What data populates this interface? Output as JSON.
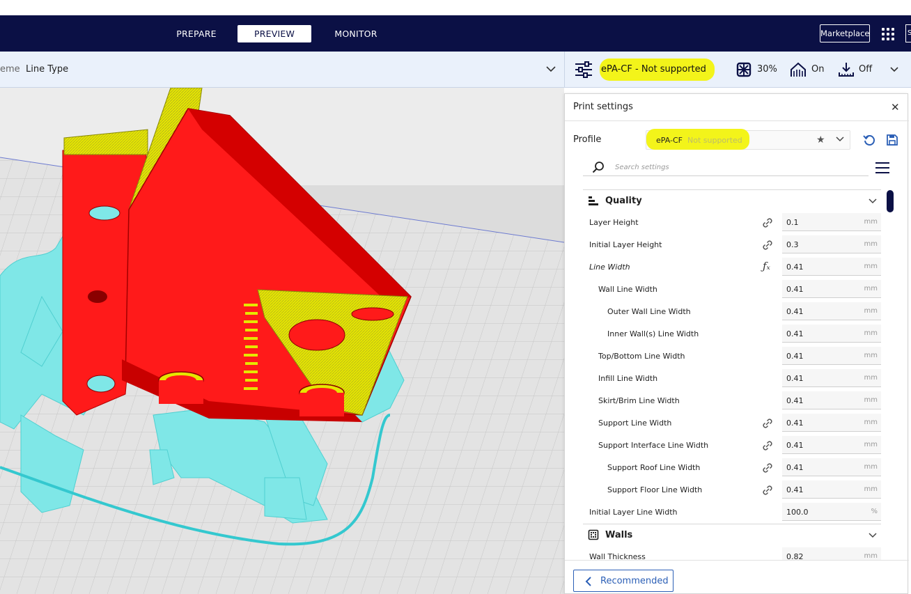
{
  "header": {
    "stage_tabs": [
      {
        "label": "PREPARE",
        "active": false
      },
      {
        "label": "PREVIEW",
        "active": true
      },
      {
        "label": "MONITOR",
        "active": false
      }
    ],
    "marketplace_label": "Marketplace",
    "cut_button_label": "S"
  },
  "view_bar": {
    "scheme_label": "eme",
    "scheme_value": "Line Type"
  },
  "print_bar": {
    "profile_label": "ePA-CF - Not supported",
    "infill_value": "30%",
    "support_value": "On",
    "adhesion_value": "Off",
    "highlight_color": "#f3f41a"
  },
  "panel": {
    "title": "Print settings",
    "profile_label": "Profile",
    "profile_name": "ePA-CF",
    "profile_status": "Not supported",
    "search_placeholder": "Search settings",
    "categories": [
      {
        "label": "Quality",
        "icon": "quality-icon"
      },
      {
        "label": "Walls",
        "icon": "walls-icon"
      }
    ],
    "settings": [
      {
        "label": "Layer Height",
        "value": "0.1",
        "unit": "mm",
        "link": true,
        "fx": false,
        "indent": 0,
        "italic": false
      },
      {
        "label": "Initial Layer Height",
        "value": "0.3",
        "unit": "mm",
        "link": true,
        "fx": false,
        "indent": 0,
        "italic": false
      },
      {
        "label": "Line Width",
        "value": "0.41",
        "unit": "mm",
        "link": false,
        "fx": true,
        "indent": 0,
        "italic": true
      },
      {
        "label": "Wall Line Width",
        "value": "0.41",
        "unit": "mm",
        "link": false,
        "fx": false,
        "indent": 1,
        "italic": false
      },
      {
        "label": "Outer Wall Line Width",
        "value": "0.41",
        "unit": "mm",
        "link": false,
        "fx": false,
        "indent": 2,
        "italic": false
      },
      {
        "label": "Inner Wall(s) Line Width",
        "value": "0.41",
        "unit": "mm",
        "link": false,
        "fx": false,
        "indent": 2,
        "italic": false
      },
      {
        "label": "Top/Bottom Line Width",
        "value": "0.41",
        "unit": "mm",
        "link": false,
        "fx": false,
        "indent": 1,
        "italic": false
      },
      {
        "label": "Infill Line Width",
        "value": "0.41",
        "unit": "mm",
        "link": false,
        "fx": false,
        "indent": 1,
        "italic": false
      },
      {
        "label": "Skirt/Brim Line Width",
        "value": "0.41",
        "unit": "mm",
        "link": false,
        "fx": false,
        "indent": 1,
        "italic": false
      },
      {
        "label": "Support Line Width",
        "value": "0.41",
        "unit": "mm",
        "link": true,
        "fx": false,
        "indent": 1,
        "italic": false
      },
      {
        "label": "Support Interface Line Width",
        "value": "0.41",
        "unit": "mm",
        "link": true,
        "fx": false,
        "indent": 1,
        "italic": false
      },
      {
        "label": "Support Roof Line Width",
        "value": "0.41",
        "unit": "mm",
        "link": true,
        "fx": false,
        "indent": 2,
        "italic": false
      },
      {
        "label": "Support Floor Line Width",
        "value": "0.41",
        "unit": "mm",
        "link": true,
        "fx": false,
        "indent": 2,
        "italic": false
      },
      {
        "label": "Initial Layer Line Width",
        "value": "100.0",
        "unit": "%",
        "link": false,
        "fx": false,
        "indent": 0,
        "italic": false
      }
    ],
    "walls_settings": [
      {
        "label": "Wall Thickness",
        "value": "0.82",
        "unit": "mm"
      }
    ],
    "recommended_label": "Recommended"
  },
  "colors": {
    "header_bg": "#0b1045",
    "accent": "#2b5fb6",
    "model_red": "#ff1a1a",
    "model_yellow": "#e6e600",
    "support_cyan": "#7fe7e7"
  }
}
